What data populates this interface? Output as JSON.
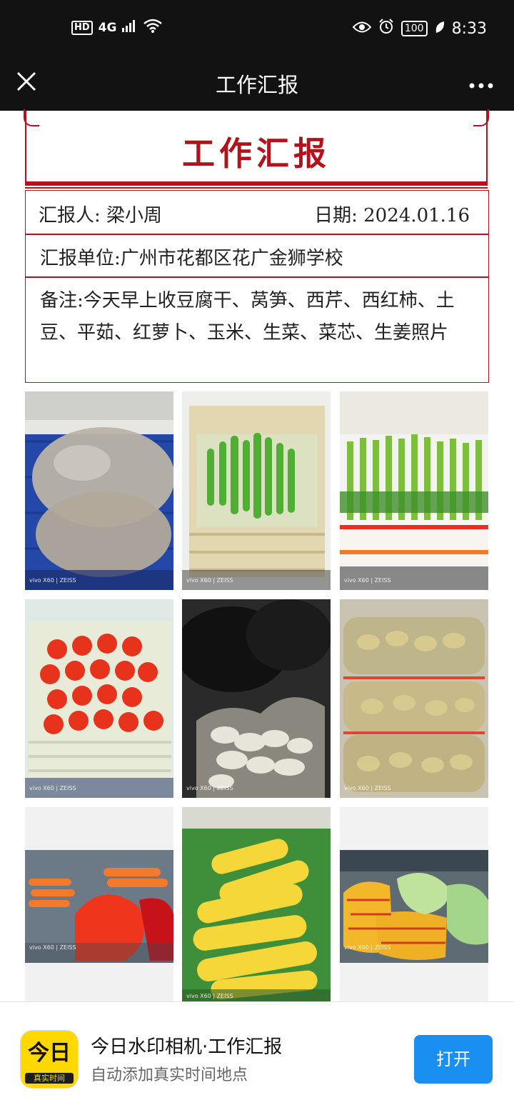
{
  "status_bar": {
    "hd": "HD",
    "network": "4G",
    "battery": "100",
    "time": "8:33"
  },
  "title_bar": {
    "title": "工作汇报"
  },
  "report": {
    "heading": "工作汇报",
    "reporter": "汇报人:  梁小周",
    "date": "日期:  2024.01.16",
    "unit": "汇报单位:广州市花都区花广金狮学校",
    "note": "备注:今天早上收豆腐干、莴笋、西芹、西红柿、土豆、平茹、红萝卜、玉米、生菜、菜芯、生姜照片"
  },
  "photos": [
    {
      "name": "tofu-photo",
      "watermark": "vivo X60 | ZEISS"
    },
    {
      "name": "lettuce-stem-photo",
      "watermark": "vivo X60 | ZEISS"
    },
    {
      "name": "celery-photo",
      "watermark": "vivo X60 | ZEISS"
    },
    {
      "name": "tomato-photo",
      "watermark": "vivo X60 | ZEISS"
    },
    {
      "name": "mushroom-photo",
      "watermark": "vivo X60 | ZEISS"
    },
    {
      "name": "potato-photo",
      "watermark": "vivo X60 | ZEISS"
    },
    {
      "name": "carrot-photo",
      "watermark": "vivo X60 | ZEISS"
    },
    {
      "name": "corn-photo",
      "watermark": "vivo X60 | ZEISS"
    },
    {
      "name": "vegetables-photo",
      "watermark": "vivo X60 | ZEISS"
    }
  ],
  "bottom_bar": {
    "app_icon_big": "今日",
    "app_icon_small": "真实时间",
    "app_title": "今日水印相机·工作汇报",
    "app_subtitle": "自动添加真实时间地点",
    "open_label": "打开"
  },
  "colors": {
    "accent_red": "#b3121d",
    "open_blue": "#1a8ff2",
    "icon_yellow": "#ffd800"
  }
}
